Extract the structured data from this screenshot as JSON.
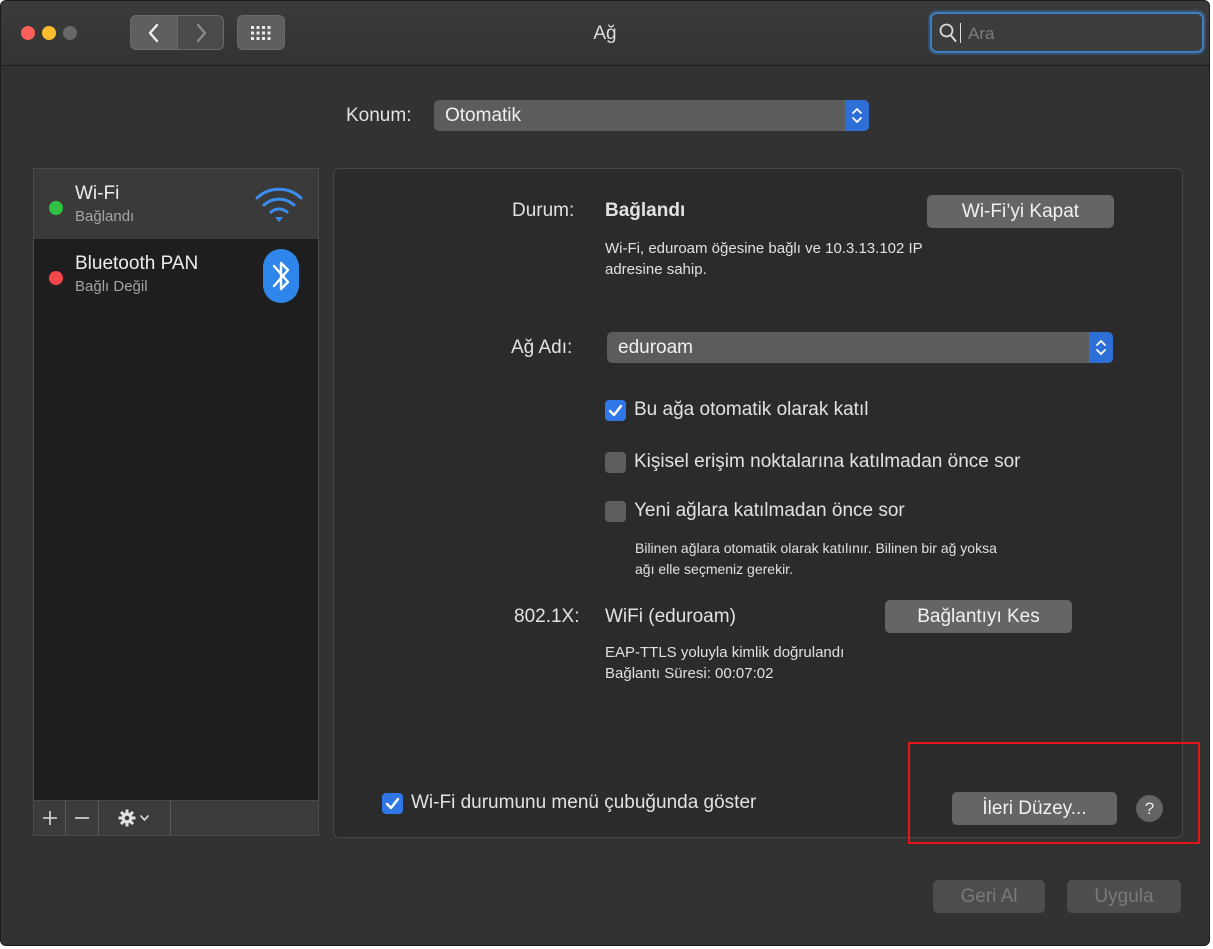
{
  "window": {
    "title": "Ağ"
  },
  "search": {
    "placeholder": "Ara"
  },
  "location": {
    "label": "Konum:",
    "value": "Otomatik"
  },
  "services": [
    {
      "name": "Wi-Fi",
      "status": "Bağlandı",
      "status_color": "#2fc341",
      "icon": "wifi-icon"
    },
    {
      "name": "Bluetooth PAN",
      "status": "Bağlı Değil",
      "status_color": "#f4474a",
      "icon": "bluetooth-icon"
    }
  ],
  "sidebar_tools": {
    "add": "+",
    "remove": "−"
  },
  "status": {
    "label": "Durum:",
    "value": "Bağlandı",
    "turn_off_button": "Wi-Fi’yi Kapat",
    "description_line1": "Wi-Fi, eduroam öğesine bağlı ve 10.3.13.102 IP",
    "description_line2": "adresine sahip."
  },
  "network_name": {
    "label": "Ağ Adı:",
    "value": "eduroam"
  },
  "options": [
    {
      "label": "Bu ağa otomatik olarak katıl",
      "checked": true
    },
    {
      "label": "Kişisel erişim noktalarına katılmadan önce sor",
      "checked": false
    },
    {
      "label": "Yeni ağlara katılmadan önce sor",
      "checked": false
    }
  ],
  "ask_note": {
    "line1": "Bilinen ağlara otomatik olarak katılınır. Bilinen bir ağ yoksa",
    "line2": "ağı elle seçmeniz gerekir."
  },
  "dot1x": {
    "label": "802.1X:",
    "value": "WiFi (eduroam)",
    "disconnect_button": "Bağlantıyı Kes",
    "auth_text": "EAP-TTLS yoluyla kimlik doğrulandı",
    "duration_text": "Bağlantı Süresi: 00:07:02"
  },
  "show_in_menu": {
    "label": "Wi-Fi durumunu menü çubuğunda göster",
    "checked": true
  },
  "advanced_button": "İleri Düzey...",
  "help_button": "?",
  "footer": {
    "revert": "Geri Al",
    "apply": "Uygula"
  },
  "colors": {
    "accent": "#2f77e6",
    "highlight_box": "#e5161b"
  }
}
